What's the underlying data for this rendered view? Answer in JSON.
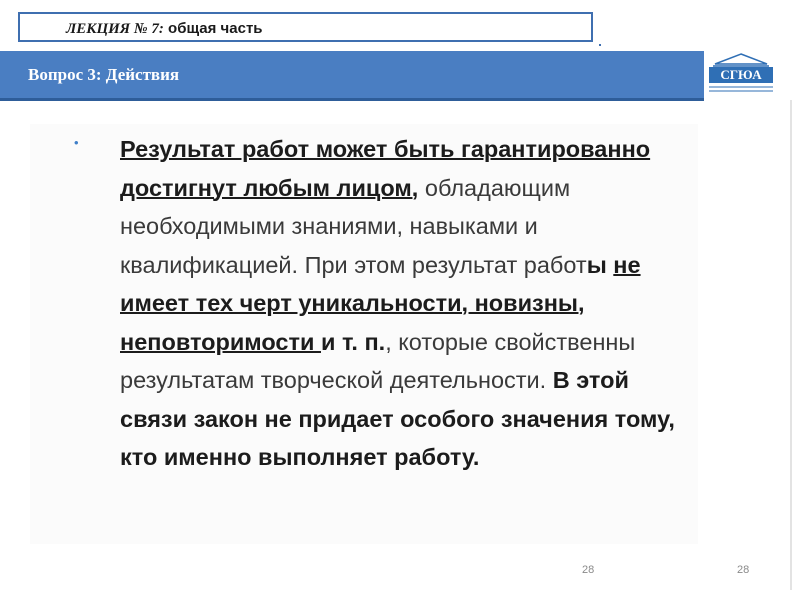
{
  "header": {
    "lecture_label": "ЛЕКЦИЯ № 7:",
    "lecture_topic": " общая часть",
    "question_title": "Вопрос 3: Действия",
    "logo_text": "СГЮА"
  },
  "body": {
    "runs": [
      {
        "text": "Результат работ может быть гарантированно достигнут любым лицом,",
        "style": "b u"
      },
      {
        "text": " обладающим необходимыми знаниями, навыками и квалификацией. При этом результат работ",
        "style": "n"
      },
      {
        "text": "ы ",
        "style": "b"
      },
      {
        "text": "не имеет тех черт уникальности, новизны, неповторимости ",
        "style": "b u"
      },
      {
        "text": "и т. п.",
        "style": "b"
      },
      {
        "text": ", которые свойственны результатам творческой деятельности. ",
        "style": "n"
      },
      {
        "text": "В этой связи закон не придает особого значения тому, кто именно выполняет работу.",
        "style": "b"
      }
    ]
  },
  "footer": {
    "page_left": "28",
    "page_right": "28"
  },
  "colors": {
    "banner": "#4a7ec2",
    "frame": "#3f6fb0",
    "bullet": "#3f7fc8"
  }
}
